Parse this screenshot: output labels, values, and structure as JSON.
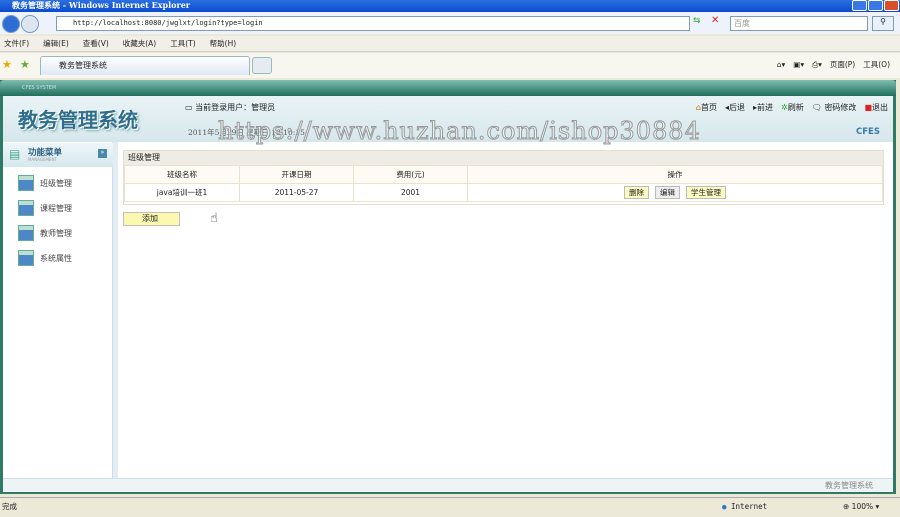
{
  "browser": {
    "title": "教务管理系统 - Windows Internet Explorer",
    "url": "http://localhost:8080/jwglxt/login?type=login",
    "search_placeholder": "百度",
    "menu": [
      "文件(F)",
      "编辑(E)",
      "查看(V)",
      "收藏夹(A)",
      "工具(T)",
      "帮助(H)"
    ],
    "tab": "教务管理系统",
    "cmd": {
      "page": "页面(P)",
      "tools": "工具(O)"
    },
    "status": "完成",
    "zone": "Internet",
    "zoom": "100%"
  },
  "app": {
    "strip": "CFES SYSTEM",
    "logo": "教务管理系统",
    "user": "当前登录用户：管理员",
    "date": "2011年5月29日 星期日 18:10:15",
    "brand": "CFES",
    "topnav": [
      "首页",
      "后退",
      "前进",
      "刷新",
      "密码修改",
      "退出"
    ],
    "menu_title": "功能菜单",
    "menu_sub": "MANAGEMENT",
    "sidebar": [
      "班级管理",
      "课程管理",
      "教师管理",
      "系统属性"
    ],
    "footer": "教务管理系统"
  },
  "panel": {
    "title": "班级管理",
    "columns": [
      "班级名称",
      "开课日期",
      "费用(元)",
      "操作"
    ],
    "rows": [
      {
        "name": "java培训一班1",
        "date": "2011-05-27",
        "fee": "2001"
      }
    ],
    "actions": [
      "删除",
      "编辑",
      "学生管理"
    ],
    "add": "添加"
  },
  "watermark": "https://www.huzhan.com/ishop30884"
}
